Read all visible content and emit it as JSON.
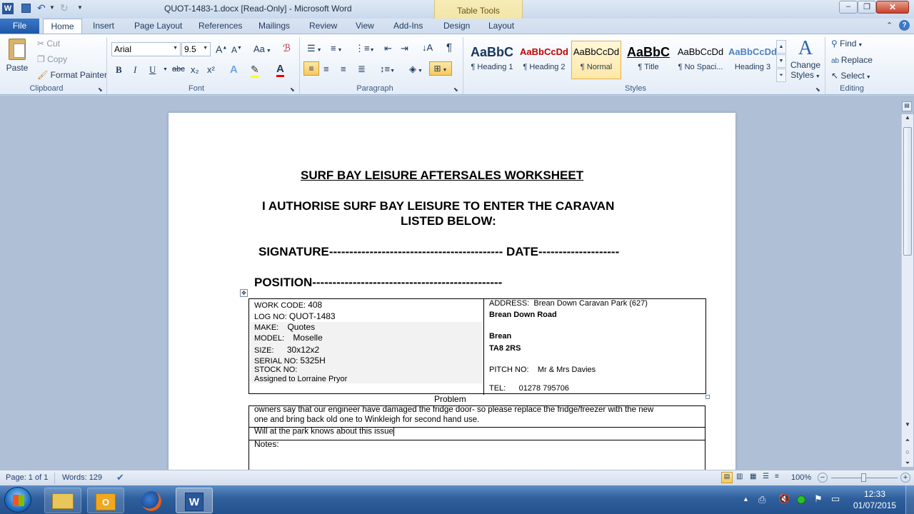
{
  "titlebar": {
    "title": "QUOT-1483-1.docx [Read-Only]  -  Microsoft Word",
    "context_tab": "Table Tools"
  },
  "tabs": [
    "File",
    "Home",
    "Insert",
    "Page Layout",
    "References",
    "Mailings",
    "Review",
    "View",
    "Add-Ins",
    "Design",
    "Layout"
  ],
  "ribbon": {
    "clipboard": {
      "paste": "Paste",
      "cut": "Cut",
      "copy": "Copy",
      "format_painter": "Format Painter",
      "label": "Clipboard"
    },
    "font": {
      "name": "Arial",
      "size": "9.5",
      "label": "Font",
      "grow": "A",
      "shrink": "A",
      "case": "Aa",
      "bold": "B",
      "italic": "I",
      "underline": "U",
      "strike": "abc",
      "sub": "x₂",
      "sup": "x²",
      "effects": "A",
      "color": "A"
    },
    "paragraph": {
      "label": "Paragraph",
      "pilcrow": "¶"
    },
    "styles": {
      "label": "Styles",
      "items": [
        {
          "sample": "AaBbC",
          "name": "¶ Heading 1",
          "color": "#17365d"
        },
        {
          "sample": "AaBbCcDd",
          "name": "¶ Heading 2",
          "color": "#c00000"
        },
        {
          "sample": "AaBbCcDd",
          "name": "¶ Normal",
          "color": "#000000"
        },
        {
          "sample": "AaBbC",
          "name": "¶ Title",
          "color": "#000000"
        },
        {
          "sample": "AaBbCcDd",
          "name": "¶ No Spaci...",
          "color": "#000000"
        },
        {
          "sample": "AaBbCcDd",
          "name": "Heading 3",
          "color": "#4f81bd"
        }
      ],
      "change": "Change",
      "change2": "Styles"
    },
    "editing": {
      "label": "Editing",
      "find": "Find",
      "replace": "Replace",
      "select": "Select"
    }
  },
  "document": {
    "title": "SURF BAY LEISURE AFTERSALES WORKSHEET",
    "auth_line1": "I AUTHORISE SURF BAY LEISURE TO ENTER THE CARAVAN",
    "auth_line2": "LISTED BELOW:",
    "signature_line": "SIGNATURE------------------------------------------- DATE--------------------",
    "position_line": "POSITION-----------------------------------------------",
    "left": {
      "work_code_label": "WORK CODE:",
      "work_code": "408",
      "log_no_label": "LOG NO:",
      "log_no": "QUOT-1483",
      "make_label": "MAKE:",
      "make": "Quotes",
      "model_label": "MODEL:",
      "model": "Moselle",
      "size_label": "SIZE:",
      "size": "30x12x2",
      "serial_label": "SERIAL  NO:",
      "serial": "5325H",
      "stock_label": "STOCK NO:",
      "assigned": "Assigned to Lorraine Pryor"
    },
    "right": {
      "address_label": "ADDRESS:",
      "address": "Brean Down Caravan Park (627)",
      "road": "Brean Down Road",
      "town": "Brean",
      "postcode": "TA8 2RS",
      "pitch_label": "PITCH NO:",
      "pitch": "Mr & Mrs Davies",
      "tel_label": "TEL:",
      "tel": "01278 795706"
    },
    "problem_label": "Problem",
    "problem_line1": "owners say that our engineer have damaged the fridge door- so please replace the fridge/freezer with the new",
    "problem_line2": "one and bring back old one to Winkleigh for second hand use.",
    "will_line": " Will at the park knows about this issue",
    "notes_label": "Notes:"
  },
  "status": {
    "page": "Page: 1 of 1",
    "words": "Words: 129",
    "zoom": "100%"
  },
  "taskbar": {
    "time": "12:33",
    "date": "01/07/2015"
  }
}
